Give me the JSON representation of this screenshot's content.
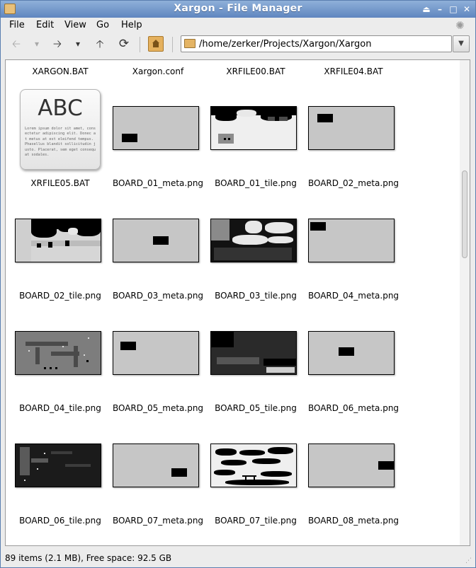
{
  "window": {
    "title": "Xargon - File Manager",
    "controls": {
      "menu": "⏏",
      "minimize": "–",
      "maximize": "□",
      "close": "✕"
    }
  },
  "menubar": {
    "items": [
      "File",
      "Edit",
      "View",
      "Go",
      "Help"
    ]
  },
  "toolbar": {
    "back": "🡠",
    "back_menu": "▾",
    "forward": "🡢",
    "forward_menu": "▾",
    "up": "🡡",
    "reload": "⟳",
    "path": "/home/zerker/Projects/Xargon/Xargon",
    "path_dropdown": "▼"
  },
  "files": [
    {
      "name": "XARGON.BAT"
    },
    {
      "name": "Xargon.conf"
    },
    {
      "name": "XRFILE00.BAT"
    },
    {
      "name": "XRFILE04.BAT"
    },
    {
      "name": "XRFILE05.BAT",
      "preview_title": "ABC",
      "preview_text": "Lorem ipsum dolor sit amet, consectetur adipiscing elit. Donec at metus at est eleifend tempus. Phasellus blandit sollicitudin justo. Placerat, sem eget consequat sodales."
    },
    {
      "name": "BOARD_01_meta.png"
    },
    {
      "name": "BOARD_01_tile.png"
    },
    {
      "name": "BOARD_02_meta.png"
    },
    {
      "name": "BOARD_02_tile.png"
    },
    {
      "name": "BOARD_03_meta.png"
    },
    {
      "name": "BOARD_03_tile.png"
    },
    {
      "name": "BOARD_04_meta.png"
    },
    {
      "name": "BOARD_04_tile.png"
    },
    {
      "name": "BOARD_05_meta.png"
    },
    {
      "name": "BOARD_05_tile.png"
    },
    {
      "name": "BOARD_06_meta.png"
    },
    {
      "name": "BOARD_06_tile.png"
    },
    {
      "name": "BOARD_07_meta.png"
    },
    {
      "name": "BOARD_07_tile.png"
    },
    {
      "name": "BOARD_08_meta.png"
    }
  ],
  "statusbar": {
    "text": "89 items (2.1 MB), Free space: 92.5 GB"
  },
  "colors": {
    "titlebar": "#5f86bf",
    "folder": "#e4b464"
  }
}
